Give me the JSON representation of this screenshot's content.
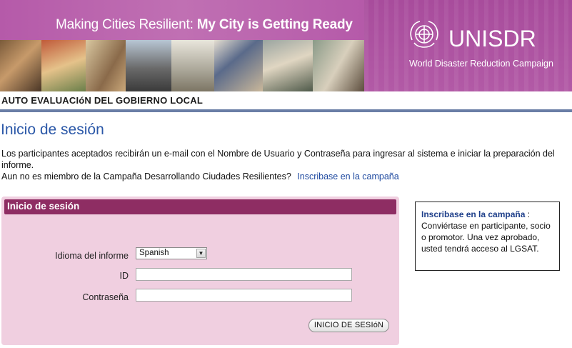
{
  "banner": {
    "title_regular": "Making Cities Resilient: ",
    "title_bold": "My City is Getting Ready",
    "logo_name": "UNISDR",
    "logo_tagline": "World Disaster Reduction Campaign",
    "icons": [
      "un-emblem-icon"
    ],
    "colors": {
      "banner": "#a5449a",
      "panel_header": "#8e2d63",
      "panel_bg": "#f0cfe0",
      "link": "#1f4aa0",
      "title": "#2b58a8",
      "rule": "#6a7ea6"
    }
  },
  "section": {
    "title": "AUTO EVALUACIóN DEL GOBIERNO LOCAL"
  },
  "page": {
    "title": "Inicio de sesión"
  },
  "intro": {
    "line1": "Los participantes aceptados recibirán un e-mail con el Nombre de Usuario y Contraseña para ingresar al sistema e iniciar la preparación del informe.",
    "line2": "Aun no es miembro de la Campaña Desarrollando Ciudades Resilientes?",
    "signup_link": "Inscribase en la campaña"
  },
  "login": {
    "header": "Inicio de sesión",
    "language_label": "Idioma del informe",
    "language_value": "Spanish",
    "id_label": "ID",
    "id_value": "",
    "password_label": "Contraseña",
    "password_value": "",
    "submit_label": "INICIO DE SESIóN"
  },
  "side": {
    "link_label": "Inscribase en la campaña",
    "separator": " :",
    "text": "Conviértase en participante, socio o promotor.  Una vez aprobado, usted tendrá acceso al LGSAT."
  }
}
